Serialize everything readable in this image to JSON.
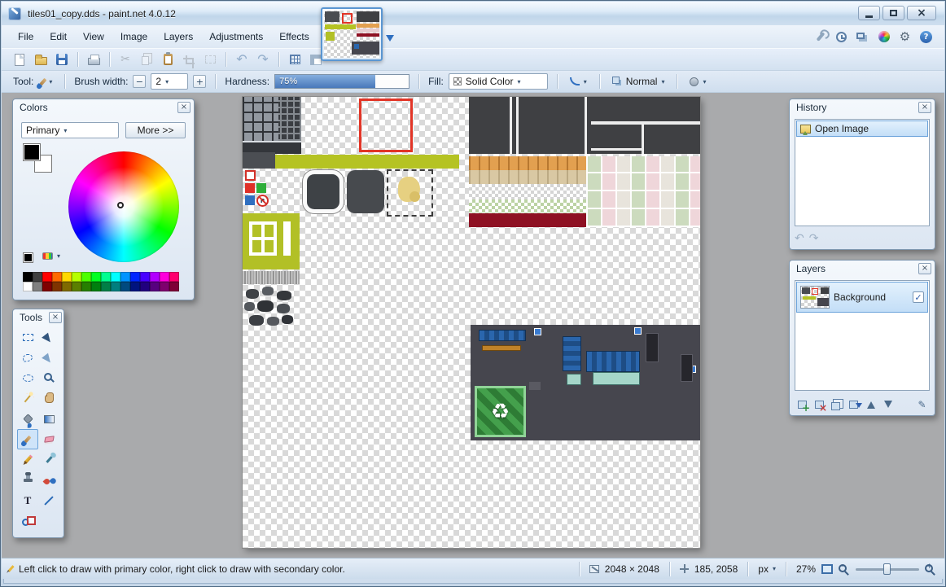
{
  "theme": {
    "selection_red": "#e23527",
    "highlight": "#cfe4f9",
    "highlight_border": "#6aa2da",
    "accent_blue": "#2f6fc0",
    "workspace_gray": "#a9aaac"
  },
  "window": {
    "title": "tiles01_copy.dds - paint.net 4.0.12"
  },
  "menu_bar": {
    "items": [
      "File",
      "Edit",
      "View",
      "Image",
      "Layers",
      "Adjustments",
      "Effects"
    ],
    "window_toggles": [
      "tools-window",
      "history-window",
      "layers-window",
      "colors-window"
    ],
    "right_icons": [
      "settings",
      "help"
    ]
  },
  "toolbar": {
    "buttons": [
      "new",
      "open",
      "save",
      "print",
      "cut",
      "copy",
      "paste",
      "crop-to-selection",
      "deselect",
      "undo",
      "redo",
      "toggle-pixel-grid",
      "toggle-rulers"
    ]
  },
  "tool_options": {
    "tool_label": "Tool:",
    "current_tool": "Paintbrush",
    "brush_width_label": "Brush width:",
    "brush_width": "2",
    "hardness_label": "Hardness:",
    "hardness": "75%",
    "fill_label": "Fill:",
    "fill": "Solid Color",
    "blend_mode": "Normal"
  },
  "colors_window": {
    "title": "Colors",
    "mode": "Primary",
    "more_button": "More >>",
    "primary": "#000000",
    "secondary": "#ffffff",
    "palette": [
      "#000000",
      "#404040",
      "#ff0000",
      "#ff6a00",
      "#ffd800",
      "#b6ff00",
      "#4cff00",
      "#00ff21",
      "#00ff90",
      "#00ffff",
      "#0094ff",
      "#0026ff",
      "#4800ff",
      "#b200ff",
      "#ff00dc",
      "#ff006e",
      "#ffffff",
      "#808080",
      "#7f0000",
      "#7f3300",
      "#7f6a00",
      "#5b7f00",
      "#267f00",
      "#007f0e",
      "#007f46",
      "#007f7f",
      "#004a7f",
      "#00137f",
      "#21007f",
      "#57007f",
      "#7f006e",
      "#7f0037"
    ]
  },
  "tools_window": {
    "title": "Tools",
    "selected": "paintbrush",
    "tools": [
      "rectangle-select",
      "move-selected-pixels",
      "lasso-select",
      "move-selection",
      "ellipse-select",
      "zoom",
      "magic-wand",
      "pan",
      "paint-bucket",
      "gradient",
      "paintbrush",
      "eraser",
      "pencil",
      "color-picker",
      "clone-stamp",
      "recolor",
      "text",
      "line-curve",
      "shapes"
    ]
  },
  "history_window": {
    "title": "History",
    "items": [
      "Open Image"
    ]
  },
  "layers_window": {
    "title": "Layers",
    "layers": [
      {
        "name": "Background",
        "visible": true
      }
    ],
    "buttons": [
      "add-layer",
      "delete-layer",
      "duplicate-layer",
      "merge-layer-down",
      "move-layer-up",
      "move-layer-down",
      "layer-properties"
    ]
  },
  "status_bar": {
    "hint": "Left click to draw with primary color, right click to draw with secondary color.",
    "image_size": "2048 × 2048",
    "cursor_position": "185, 2058",
    "unit": "px",
    "zoom": "27%"
  }
}
